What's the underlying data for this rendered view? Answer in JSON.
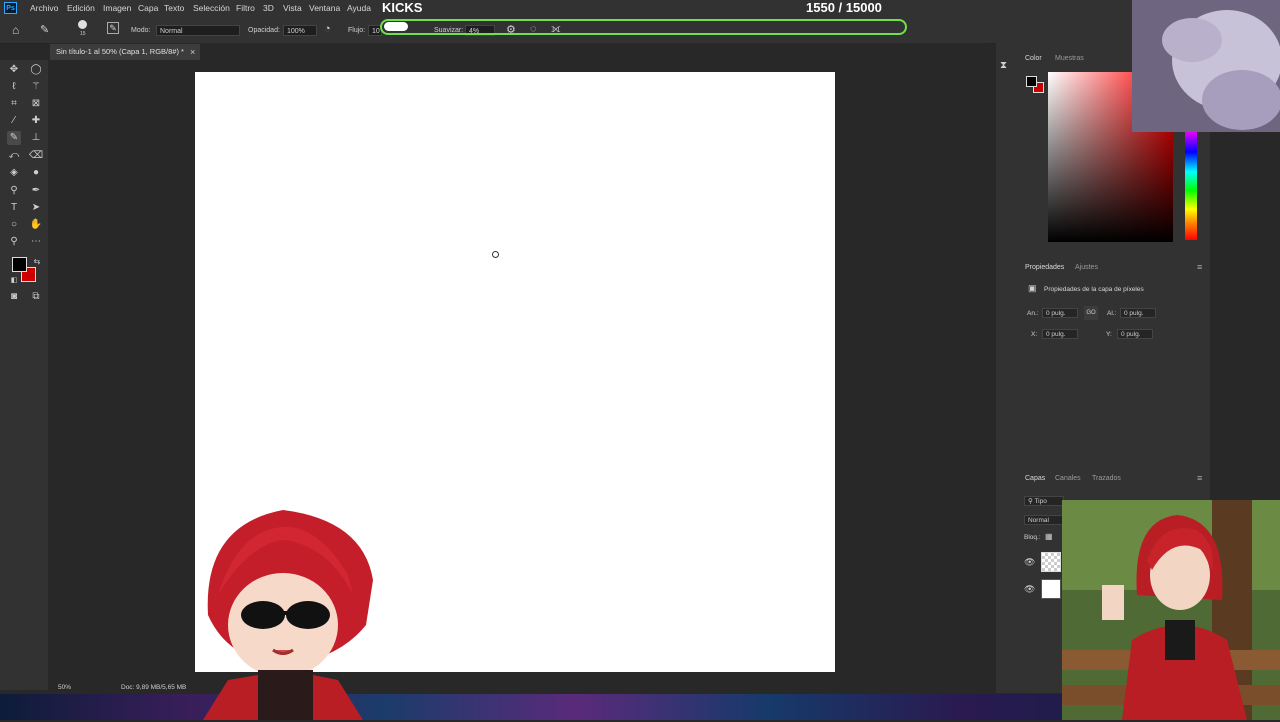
{
  "app": {
    "logo_text": "Ps"
  },
  "menu": [
    "Archivo",
    "Edición",
    "Imagen",
    "Capa",
    "Texto",
    "Selección",
    "Filtro",
    "3D",
    "Vista",
    "Ventana",
    "Ayuda"
  ],
  "overlay": {
    "kicks_title": "KICKS",
    "kicks_counter": "1550  / 15000",
    "kicks_progress": 0.103,
    "bar_color": "#6fe24a"
  },
  "options": {
    "brush_size": "15",
    "mode_label": "Modo:",
    "mode_value": "Normal",
    "opacity_label": "Opacidad:",
    "opacity_value": "100%",
    "flow_label": "Flujo:",
    "flow_value": "10",
    "smooth_label": "Suavizar:",
    "smooth_value": "4%"
  },
  "document": {
    "tab_title": "Sin título-1 al 50% (Capa 1, RGB/8#) *",
    "close": "×",
    "zoom": "50%",
    "doc_info": "Doc: 9,89 MB/5,65 MB"
  },
  "tools": [
    "move-icon",
    "marquee-icon",
    "lasso-icon",
    "magic-wand-icon",
    "crop-icon",
    "frame-icon",
    "eyedropper-icon",
    "healing-icon",
    "brush-icon",
    "stamp-icon",
    "history-brush-icon",
    "eraser-icon",
    "bucket-icon",
    "blur-icon",
    "dodge-icon",
    "pen-icon",
    "type-icon",
    "path-select-icon",
    "ellipse-icon",
    "hand-icon",
    "zoom-icon",
    "more-icon"
  ],
  "colors": {
    "foreground": "#000000",
    "background": "#cc0000",
    "accent": "#6fe24a"
  },
  "color_panel": {
    "tab_color": "Color",
    "tab_swatches": "Muestras"
  },
  "properties_panel": {
    "tab_properties": "Propiedades",
    "tab_adjust": "Ajustes",
    "layer_title": "Propiedades de la capa de píxeles",
    "w_label": "An.:",
    "w_value": "0 pulg.",
    "h_label": "Al.:",
    "h_value": "0 pulg.",
    "x_label": "X:",
    "x_value": "0 pulg.",
    "y_label": "Y:",
    "y_value": "0 pulg.",
    "link": "GO"
  },
  "layers_panel": {
    "tab_layers": "Capas",
    "tab_channels": "Canales",
    "tab_paths": "Trazados",
    "filter": "Tipo",
    "blend": "Normal",
    "lock": "Bloq.:"
  }
}
